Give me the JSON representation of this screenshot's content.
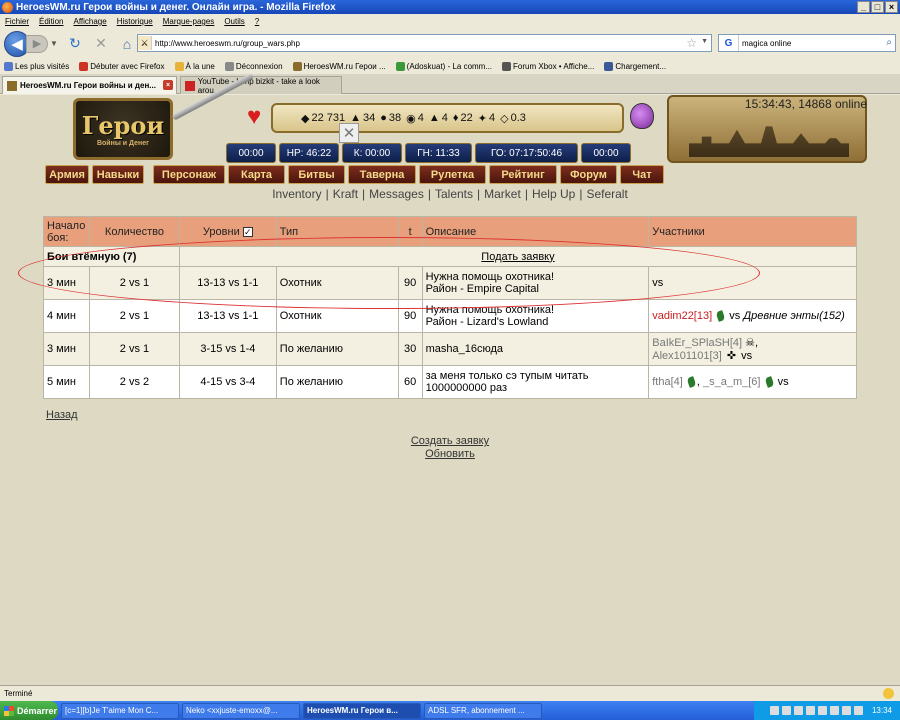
{
  "window": {
    "title": "HeroesWM.ru Герои войны и денег. Онлайн игра. - Mozilla Firefox",
    "buttons": [
      "_",
      "□",
      "×"
    ]
  },
  "menu": [
    "Fichier",
    "Édition",
    "Affichage",
    "Historique",
    "Marque-pages",
    "Outils",
    "?"
  ],
  "nav": {
    "url": "http://www.heroeswm.ru/group_wars.php",
    "search_value": "magica online",
    "search_engine_label": "G"
  },
  "bookmarks": [
    {
      "label": "Les plus visités",
      "color": "#5577cc"
    },
    {
      "label": "Débuter avec Firefox",
      "color": "#cc3322"
    },
    {
      "label": "À la une",
      "color": "#e8b23a"
    },
    {
      "label": "Déconnexion",
      "color": "#888888"
    },
    {
      "label": "HeroesWM.ru Герои ...",
      "color": "#8a6c2a"
    },
    {
      "label": "(Adoskuat) - La comm...",
      "color": "#3a9a3a"
    },
    {
      "label": "Forum Xbox • Affiche...",
      "color": "#555555"
    },
    {
      "label": "Chargement...",
      "color": "#3b5998"
    }
  ],
  "tabs": [
    {
      "label": "HeroesWM.ru Герои войны и ден..."
    },
    {
      "label": "YouTube - Limp bizkit - take a look arou..."
    }
  ],
  "game": {
    "logo_main": "Герои",
    "logo_sub": "Войны и Денег",
    "online_info": "15:34:43, 14868 online",
    "resources": [
      {
        "icon": "gold-icon",
        "glyph": "◆",
        "value": "22 731"
      },
      {
        "icon": "wood-icon",
        "glyph": "▲",
        "value": "34"
      },
      {
        "icon": "ore-icon",
        "glyph": "●",
        "value": "38"
      },
      {
        "icon": "mercury-icon",
        "glyph": "◉",
        "value": "4"
      },
      {
        "icon": "sulfur-icon",
        "glyph": "▲",
        "value": "4"
      },
      {
        "icon": "crystal-icon",
        "glyph": "♦",
        "value": "22"
      },
      {
        "icon": "gem-icon",
        "glyph": "✦",
        "value": "4"
      },
      {
        "icon": "diamond-icon",
        "glyph": "◇",
        "value": "0.3"
      }
    ],
    "timers": [
      {
        "label": "00:00",
        "width": 50
      },
      {
        "label": "HP: 46:22",
        "width": 60
      },
      {
        "label": "К: 00:00",
        "width": 60
      },
      {
        "label": "ГН: 11:33",
        "width": 67
      },
      {
        "label": "ГО: 07:17:50:46",
        "width": 103
      },
      {
        "label": "00:00",
        "width": 50
      }
    ],
    "menu": [
      {
        "label": "Армия",
        "width": 44
      },
      {
        "label": "Навыки",
        "width": 52
      },
      {
        "label": "Персонаж",
        "width": 72
      },
      {
        "label": "Карта",
        "width": 57
      },
      {
        "label": "Битвы",
        "width": 57
      },
      {
        "label": "Таверна",
        "width": 68
      },
      {
        "label": "Рулетка",
        "width": 67
      },
      {
        "label": "Рейтинг",
        "width": 68
      },
      {
        "label": "Форум",
        "width": 57
      },
      {
        "label": "Чат",
        "width": 44
      }
    ],
    "subnav": [
      "Inventory",
      "Kraft",
      "Messages",
      "Talents",
      "Market",
      "Help Up",
      "Seferalt"
    ]
  },
  "table": {
    "headers": {
      "start": "Начало боя:",
      "count": "Количество",
      "levels": "Уровни",
      "type": "Тип",
      "t": "t",
      "description": "Описание",
      "participants": "Участники"
    },
    "group_label": "Бои втёмную (7)",
    "submit_link": "Подать заявку",
    "rows": [
      {
        "start": "3 мин",
        "count": "2 vs 1",
        "levels": "13-13 vs 1-1",
        "type": "Охотник",
        "t": "90",
        "desc1": "Нужна помощь охотника!",
        "desc2": "Район - Empire Capital",
        "participants": "vs"
      },
      {
        "start": "4 мин",
        "count": "2 vs 1",
        "levels": "13-13 vs 1-1",
        "type": "Охотник",
        "t": "90",
        "desc1": "Нужна помощь охотника!",
        "desc2": "Район - Lizard's Lowland",
        "p_name": "vadim22[13]",
        "p_vs": "vs",
        "p_enemy": "Древние энты(152)"
      },
      {
        "start": "3 мин",
        "count": "2 vs 1",
        "levels": "3-15 vs 1-4",
        "type": "По желанию",
        "t": "30",
        "desc1": "masha_16сюда",
        "p1": "BaIkEr_SPlaSH[4]",
        "p2": "Alex101101[3]",
        "p_vs": "vs"
      },
      {
        "start": "5 мин",
        "count": "2 vs 2",
        "levels": "4-15 vs 3-4",
        "type": "По желанию",
        "t": "60",
        "desc1": "за меня только сэ тупым читать",
        "desc2": "1000000000 раз",
        "p1": "ftha[4]",
        "p2": "_s_a_m_[6]",
        "p_vs": "vs"
      }
    ]
  },
  "links": {
    "back": "Назад",
    "create": "Создать заявку",
    "refresh": "Обновить"
  },
  "status": "Terminé",
  "taskbar": {
    "start": "Démarrer",
    "items": [
      {
        "label": "[c=1][b]Je T'aime Mon C...",
        "active": false
      },
      {
        "label": "Neko <xxjuste-emoxx@...",
        "active": false
      },
      {
        "label": "HeroesWM.ru Герои в...",
        "active": true
      },
      {
        "label": "ADSL SFR, abonnement ...",
        "active": false
      }
    ],
    "clock": "13:34"
  }
}
